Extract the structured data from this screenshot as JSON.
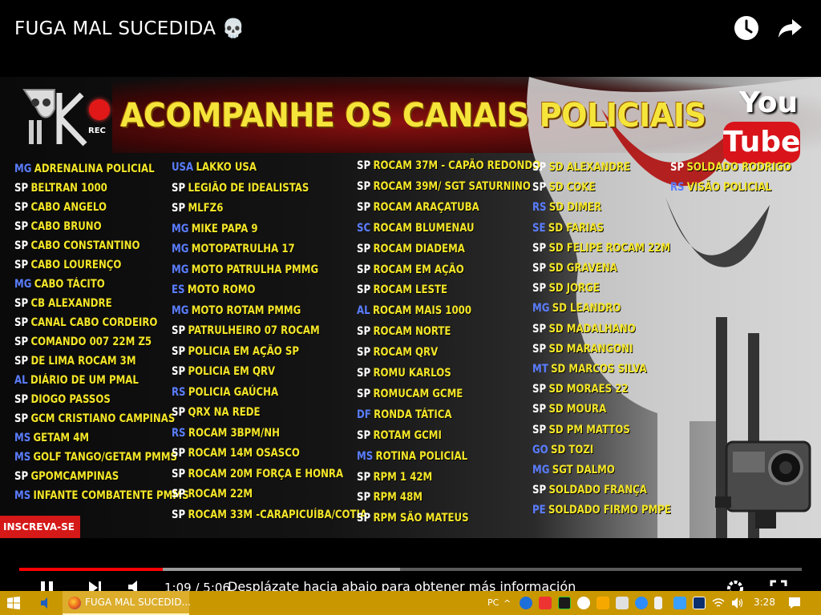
{
  "video": {
    "title": "FUGA MAL SUCEDIDA 💀",
    "headline": "ACOMPANHE OS CANAIS POLICIAIS",
    "rec_label": "REC",
    "yt_you": "You",
    "yt_tube": "Tube",
    "subscribe_label": "INSCREVA-SE",
    "overlay_message": "Desplázate hacia abajo para obtener más información",
    "time_display": "1:09 / 5:06",
    "progress_played_fraction": 0.183,
    "progress_buffered_fraction": 0.487
  },
  "channels": {
    "col1": [
      {
        "state": "MG",
        "name": "ADRENALINA POLICIAL"
      },
      {
        "state": "SP",
        "name": "BELTRAN 1000"
      },
      {
        "state": "SP",
        "name": "CABO ANGELO"
      },
      {
        "state": "SP",
        "name": "CABO BRUNO"
      },
      {
        "state": "SP",
        "name": "CABO CONSTANTINO"
      },
      {
        "state": "SP",
        "name": "CABO LOURENÇO"
      },
      {
        "state": "MG",
        "name": "CABO TÁCITO"
      },
      {
        "state": "SP",
        "name": "CB ALEXANDRE"
      },
      {
        "state": "SP",
        "name": "CANAL CABO CORDEIRO"
      },
      {
        "state": "SP",
        "name": "COMANDO 007 22M Z5"
      },
      {
        "state": "SP",
        "name": "DE LIMA ROCAM 3M"
      },
      {
        "state": "AL",
        "name": "DIÁRIO DE UM PMAL"
      },
      {
        "state": "SP",
        "name": "DIOGO PASSOS"
      },
      {
        "state": "SP",
        "name": "GCM CRISTIANO CAMPINAS"
      },
      {
        "state": "MS",
        "name": "GETAM 4M"
      },
      {
        "state": "MS",
        "name": "GOLF TANGO/GETAM PMMS"
      },
      {
        "state": "SP",
        "name": "GPOMCAMPINAS"
      },
      {
        "state": "MS",
        "name": "INFANTE COMBATENTE PMMS"
      }
    ],
    "col2": [
      {
        "state": "USA",
        "name": "LAKKO USA"
      },
      {
        "state": "SP",
        "name": "LEGIÃO DE IDEALISTAS"
      },
      {
        "state": "SP",
        "name": "MLFZ6"
      },
      {
        "state": "MG",
        "name": "MIKE PAPA 9"
      },
      {
        "state": "MG",
        "name": "MOTOPATRULHA 17"
      },
      {
        "state": "MG",
        "name": "MOTO PATRULHA PMMG"
      },
      {
        "state": "ES",
        "name": "MOTO ROMO"
      },
      {
        "state": "MG",
        "name": "MOTO ROTAM PMMG"
      },
      {
        "state": "SP",
        "name": "PATRULHEIRO 07 ROCAM"
      },
      {
        "state": "SP",
        "name": "POLICIA EM AÇÃO SP"
      },
      {
        "state": "SP",
        "name": "POLICIA EM QRV"
      },
      {
        "state": "RS",
        "name": "POLICIA GAÚCHA"
      },
      {
        "state": "SP",
        "name": "QRX NA REDE"
      },
      {
        "state": "RS",
        "name": "ROCAM 3BPM/NH"
      },
      {
        "state": "SP",
        "name": "ROCAM 14M OSASCO"
      },
      {
        "state": "SP",
        "name": "ROCAM 20M FORÇA E HONRA"
      },
      {
        "state": "SP",
        "name": "ROCAM 22M"
      },
      {
        "state": "SP",
        "name": "ROCAM 33M -CARAPICUÍBA/COTIA"
      }
    ],
    "col3": [
      {
        "state": "SP",
        "name": "ROCAM 37M - CAPÃO REDONDO"
      },
      {
        "state": "SP",
        "name": "ROCAM 39M/ SGT SATURNINO"
      },
      {
        "state": "SP",
        "name": "ROCAM ARAÇATUBA"
      },
      {
        "state": "SC",
        "name": "ROCAM BLUMENAU"
      },
      {
        "state": "SP",
        "name": "ROCAM DIADEMA"
      },
      {
        "state": "SP",
        "name": "ROCAM EM AÇÃO"
      },
      {
        "state": "SP",
        "name": "ROCAM LESTE"
      },
      {
        "state": "AL",
        "name": "ROCAM MAIS 1000"
      },
      {
        "state": "SP",
        "name": "ROCAM NORTE"
      },
      {
        "state": "SP",
        "name": "ROCAM QRV"
      },
      {
        "state": "SP",
        "name": "ROMU KARLOS"
      },
      {
        "state": "SP",
        "name": "ROMUCAM GCME"
      },
      {
        "state": "DF",
        "name": "RONDA TÁTICA"
      },
      {
        "state": "SP",
        "name": "ROTAM GCMI"
      },
      {
        "state": "MS",
        "name": "ROTINA POLICIAL"
      },
      {
        "state": "SP",
        "name": "RPM 1 42M"
      },
      {
        "state": "SP",
        "name": "RPM 48M"
      },
      {
        "state": "SP",
        "name": "RPM SÃO MATEUS"
      }
    ],
    "col4": [
      {
        "state": "SP",
        "name": "SD ALEXANDRE"
      },
      {
        "state": "SP",
        "name": "SD COKE"
      },
      {
        "state": "RS",
        "name": "SD DIMER"
      },
      {
        "state": "SE",
        "name": "SD FARIAS"
      },
      {
        "state": "SP",
        "name": "SD FELIPE ROCAM 22M"
      },
      {
        "state": "SP",
        "name": "SD GRAVENA"
      },
      {
        "state": "SP",
        "name": "SD JORGE"
      },
      {
        "state": "MG",
        "name": "SD LEANDRO"
      },
      {
        "state": "SP",
        "name": "SD MADALHANO"
      },
      {
        "state": "SP",
        "name": "SD MARANGONI"
      },
      {
        "state": "MT",
        "name": "SD MARCOS SILVA"
      },
      {
        "state": "SP",
        "name": "SD MORAES 22"
      },
      {
        "state": "SP",
        "name": "SD MOURA"
      },
      {
        "state": "SP",
        "name": "SD PM MATTOS"
      },
      {
        "state": "GO",
        "name": "SD TOZI"
      },
      {
        "state": "MG",
        "name": "SGT DALMO"
      },
      {
        "state": "SP",
        "name": "SOLDADO FRANÇA"
      },
      {
        "state": "PE",
        "name": "SOLDADO FIRMO PMPE"
      }
    ],
    "col5": [
      {
        "state": "SP",
        "name": "SOLDADO RODRIGO"
      },
      {
        "state": "RS",
        "name": "VISÃO POLICIAL"
      }
    ]
  },
  "taskbar": {
    "app_label": "FUGA MAL SUCEDID...",
    "input_lang": "PC",
    "clock": "3:28"
  },
  "colors": {
    "headline": "#f5e53a",
    "channel_name": "#f4e628",
    "progress_played": "#ff0000",
    "taskbar": "#c99700"
  }
}
